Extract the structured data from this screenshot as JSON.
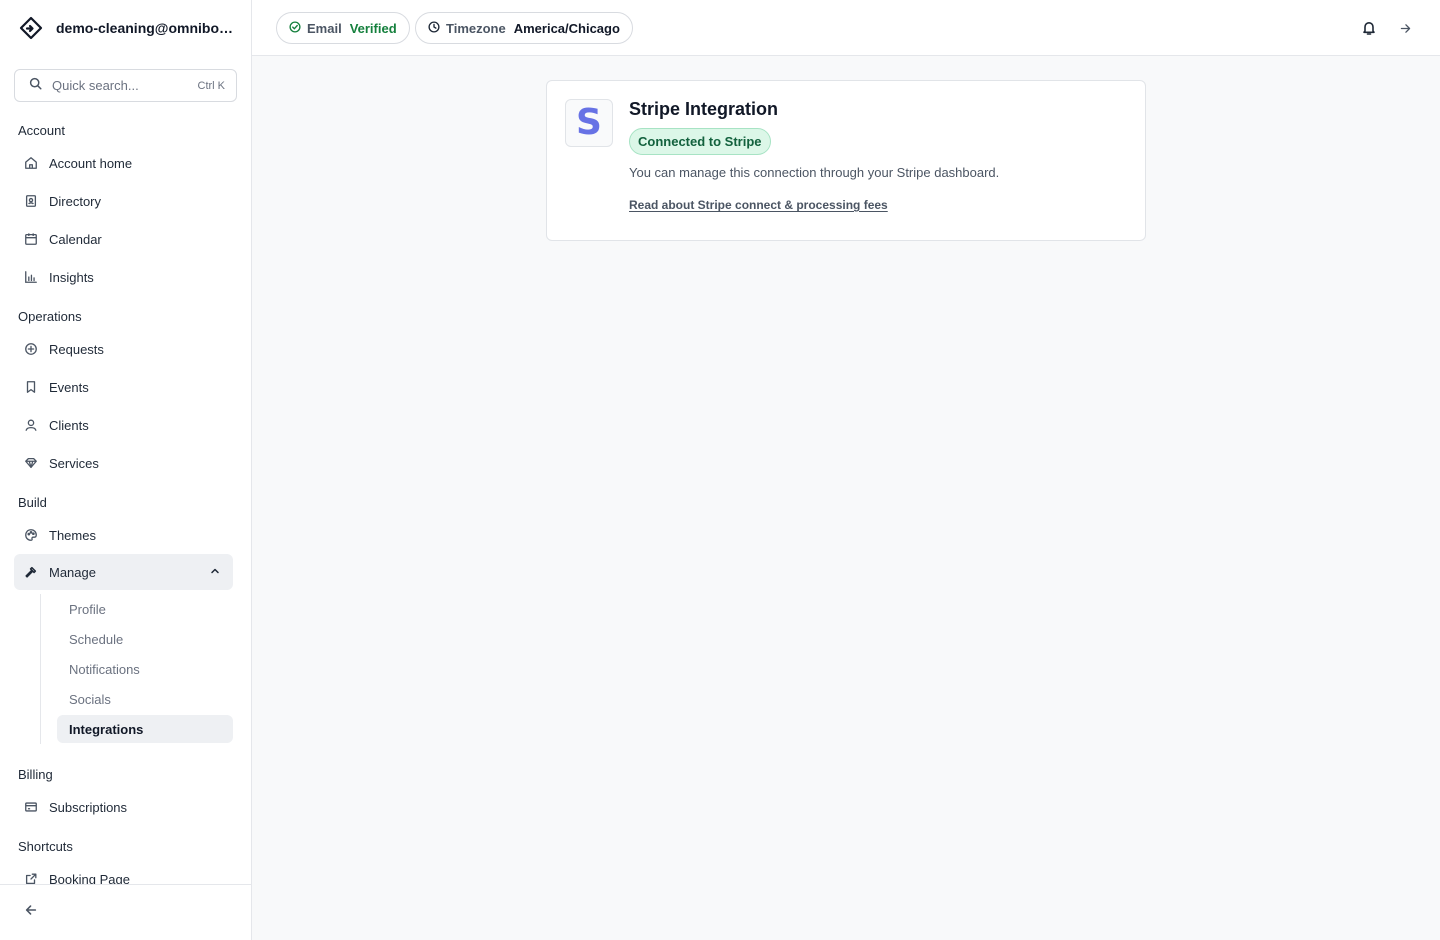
{
  "workspace": {
    "name": "demo-cleaning@omnibooking.com",
    "logo_icon": "diamond-arrow-icon"
  },
  "search": {
    "placeholder": "Quick search...",
    "shortcut": "Ctrl K"
  },
  "sidebar": {
    "sections": [
      {
        "label": "Account",
        "items": [
          {
            "label": "Account home",
            "icon": "home-icon"
          },
          {
            "label": "Directory",
            "icon": "contacts-book-icon"
          },
          {
            "label": "Calendar",
            "icon": "calendar-icon"
          },
          {
            "label": "Insights",
            "icon": "bar-chart-icon"
          }
        ]
      },
      {
        "label": "Operations",
        "items": [
          {
            "label": "Requests",
            "icon": "plus-circle-icon"
          },
          {
            "label": "Events",
            "icon": "bookmark-icon"
          },
          {
            "label": "Clients",
            "icon": "user-icon"
          },
          {
            "label": "Services",
            "icon": "gem-icon"
          }
        ]
      },
      {
        "label": "Build",
        "items": [
          {
            "label": "Themes",
            "icon": "palette-icon"
          },
          {
            "label": "Manage",
            "icon": "hammer-icon",
            "expanded": true,
            "children": [
              "Profile",
              "Schedule",
              "Notifications",
              "Socials",
              "Integrations"
            ],
            "active_child": "Integrations"
          }
        ]
      },
      {
        "label": "Billing",
        "items": [
          {
            "label": "Subscriptions",
            "icon": "credit-card-icon"
          }
        ]
      },
      {
        "label": "Shortcuts",
        "items": [
          {
            "label": "Booking Page",
            "icon": "external-link-icon"
          }
        ]
      }
    ]
  },
  "topbar": {
    "email": {
      "key": "Email",
      "value": "Verified",
      "value_color": "#15803d"
    },
    "timezone": {
      "key": "Timezone",
      "value": "America/Chicago"
    }
  },
  "integration": {
    "logo_letter": "S",
    "logo_color": "#6772e5",
    "title": "Stripe Integration",
    "status": "Connected to Stripe",
    "description": "You can manage this connection through your Stripe dashboard.",
    "link": "Read about Stripe connect & processing fees"
  }
}
